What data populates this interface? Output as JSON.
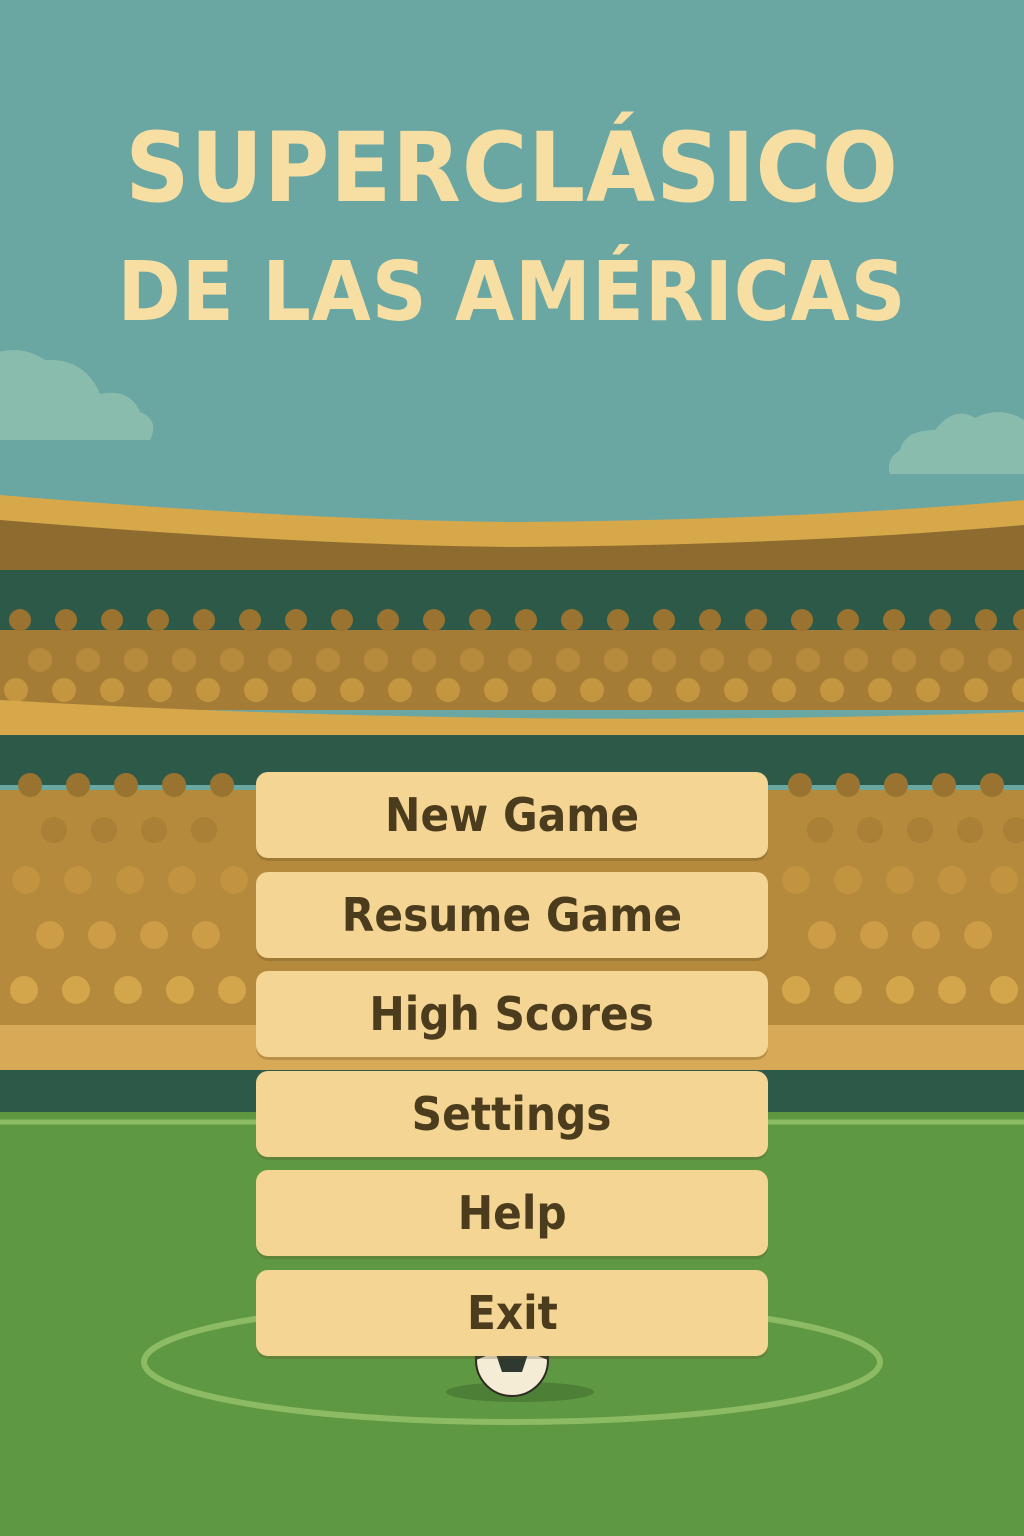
{
  "title": {
    "line1": "SUPERCLÁSICO",
    "line2": "DE LAS AMÉRICAS"
  },
  "menu": {
    "items": [
      {
        "label": "New Game"
      },
      {
        "label": "Resume Game"
      },
      {
        "label": "High Scores"
      },
      {
        "label": "Settings"
      },
      {
        "label": "Help"
      },
      {
        "label": "Exit"
      }
    ]
  },
  "colors": {
    "sky": "#6aa6a2",
    "title_text": "#f7dea3",
    "stand_gold": "#d6a84a",
    "stand_brown": "#8e6b2f",
    "stand_green": "#2d5a48",
    "pitch": "#5e9843",
    "button_bg": "#f5d594",
    "button_text": "#4a3c1d"
  },
  "icons": [
    "cloud-icon",
    "soccer-ball-icon"
  ]
}
